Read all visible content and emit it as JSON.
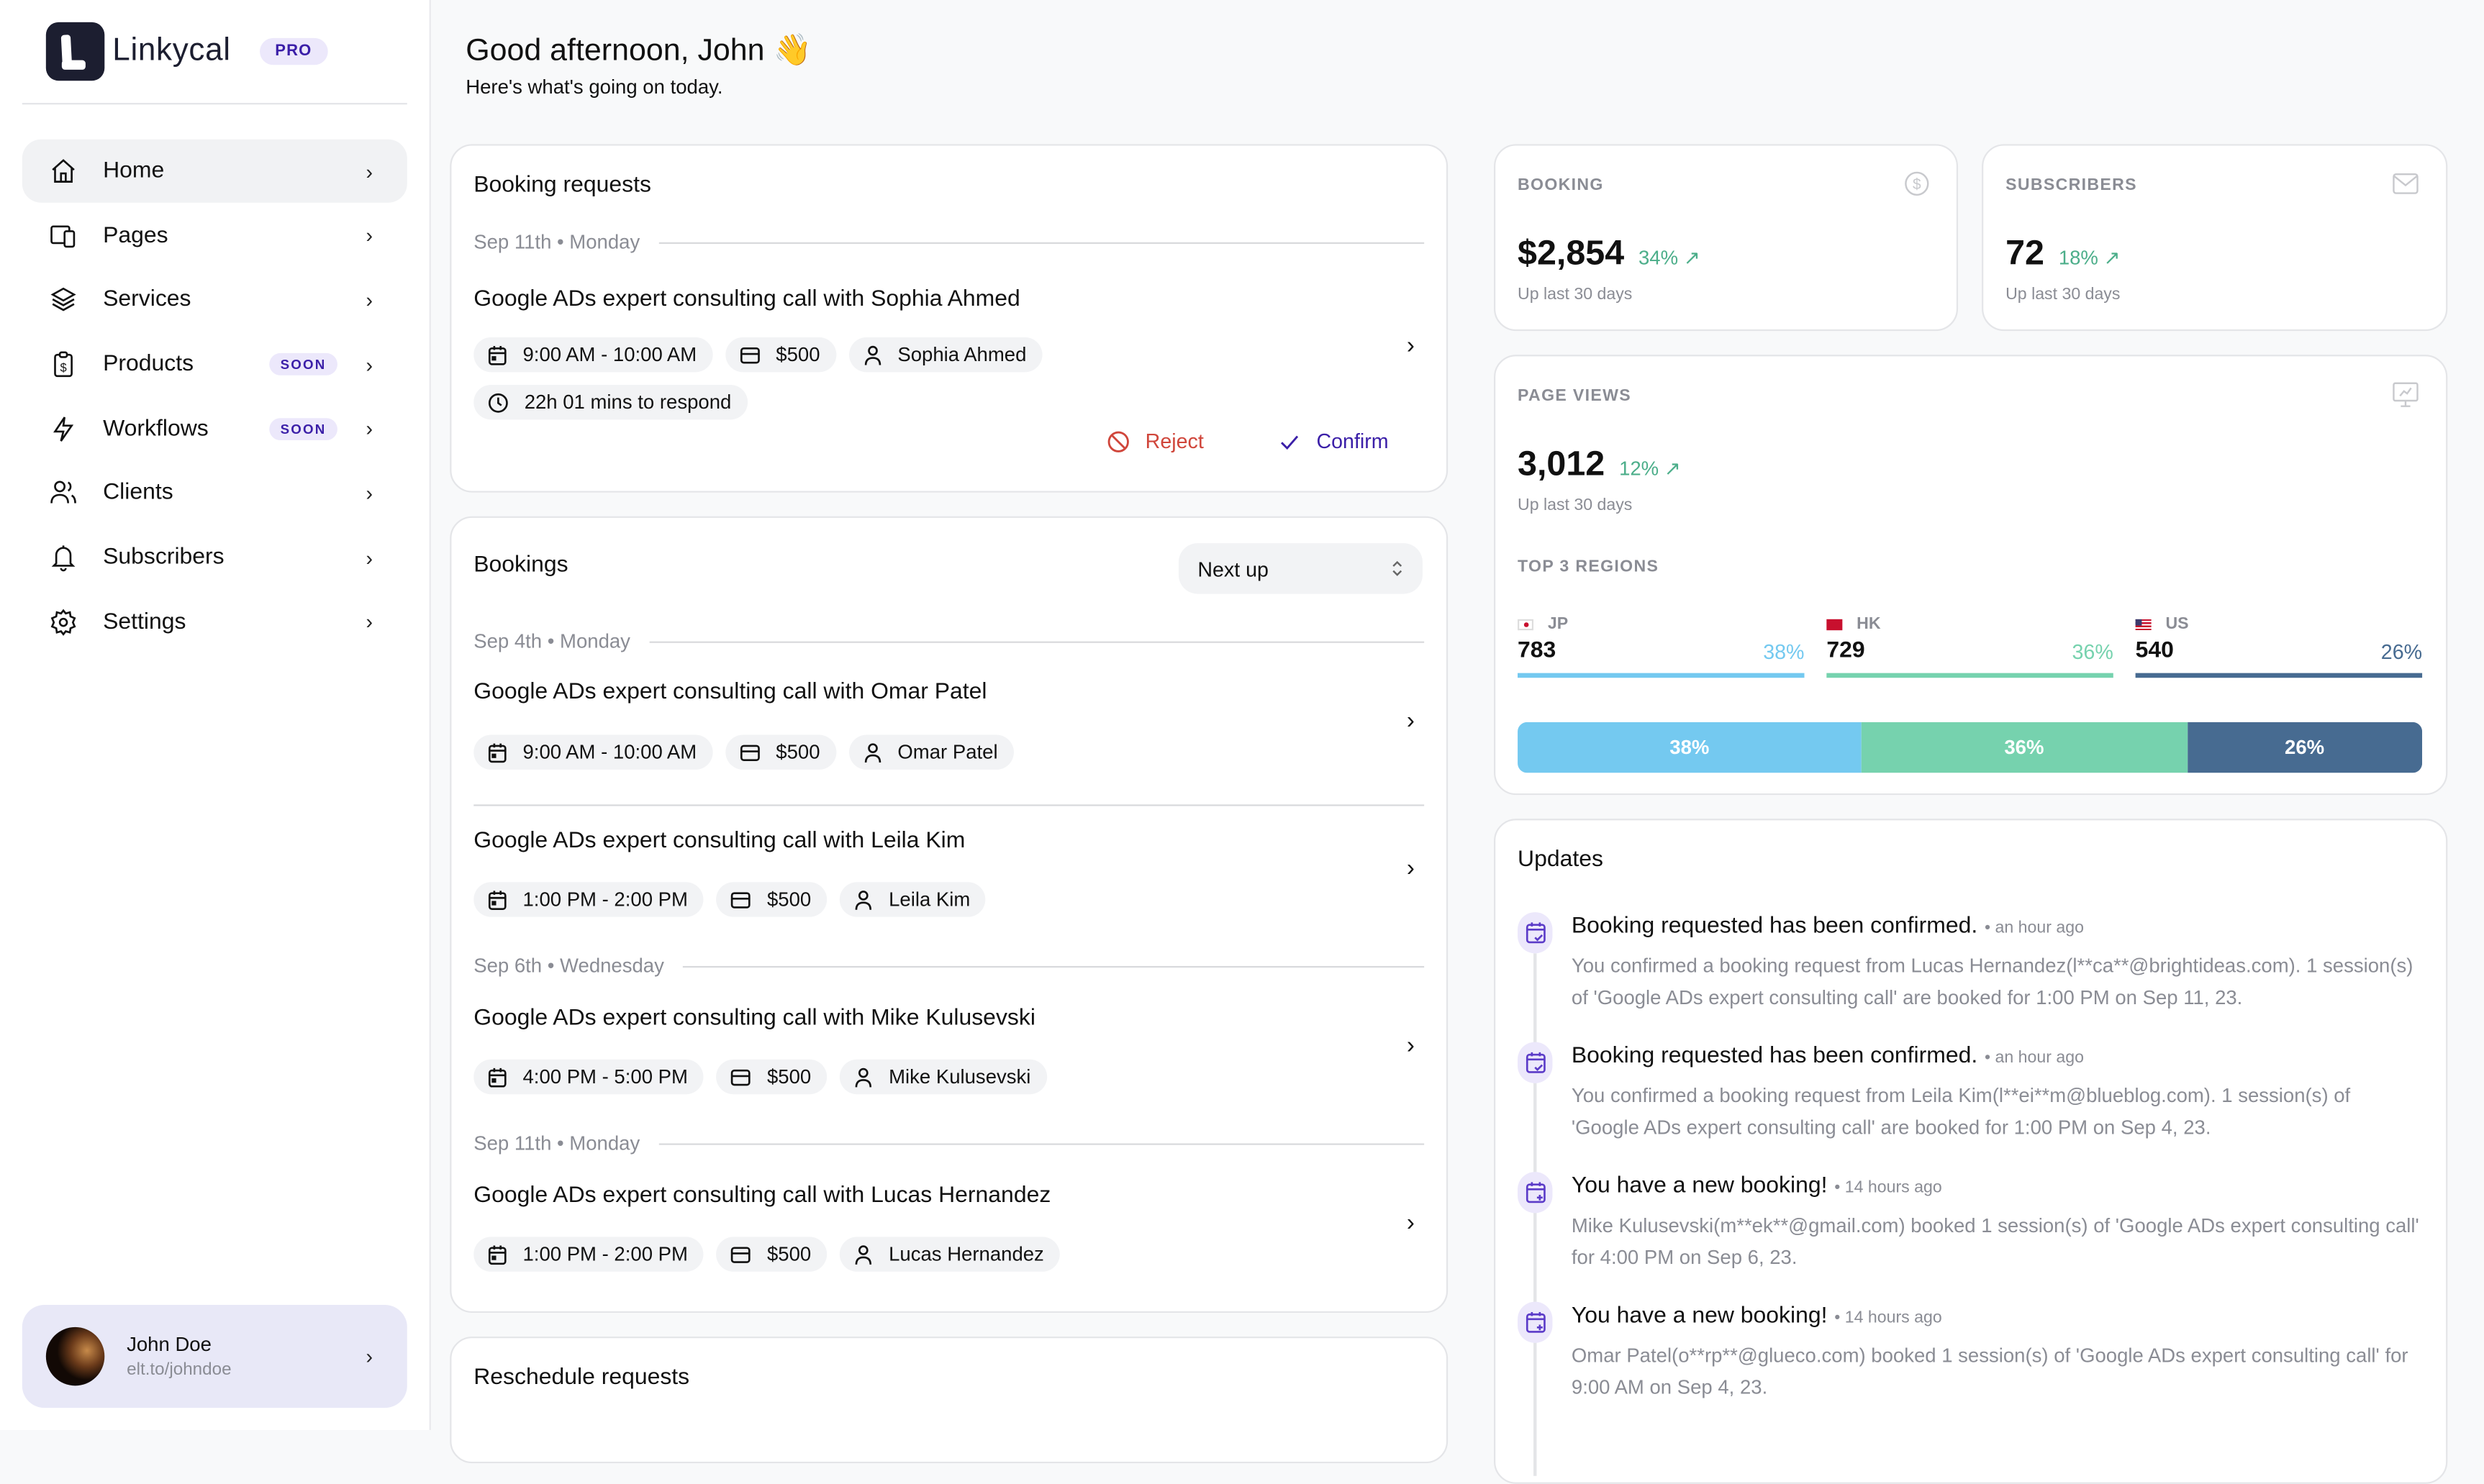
{
  "app": {
    "name": "Linkycal",
    "plan_badge": "PRO"
  },
  "sidebar": {
    "items": [
      {
        "label": "Home",
        "icon": "home-icon",
        "active": true,
        "badge": ""
      },
      {
        "label": "Pages",
        "icon": "pages-icon",
        "active": false,
        "badge": ""
      },
      {
        "label": "Services",
        "icon": "layers-icon",
        "active": false,
        "badge": ""
      },
      {
        "label": "Products",
        "icon": "clipboard-dollar-icon",
        "active": false,
        "badge": "SOON"
      },
      {
        "label": "Workflows",
        "icon": "lightning-icon",
        "active": false,
        "badge": "SOON"
      },
      {
        "label": "Clients",
        "icon": "users-icon",
        "active": false,
        "badge": ""
      },
      {
        "label": "Subscribers",
        "icon": "bell-icon",
        "active": false,
        "badge": ""
      },
      {
        "label": "Settings",
        "icon": "gear-icon",
        "active": false,
        "badge": ""
      }
    ],
    "profile": {
      "name": "John Doe",
      "link": "elt.to/johndoe"
    }
  },
  "header": {
    "greeting": "Good afternoon, John 👋",
    "subtitle": "Here's what's going on today."
  },
  "booking_requests": {
    "title": "Booking requests",
    "date": "Sep 11th • Monday",
    "event_title": "Google ADs expert consulting call with Sophia Ahmed",
    "time": "9:00 AM - 10:00 AM",
    "price": "$500",
    "client": "Sophia Ahmed",
    "respond": "22h 01 mins to respond",
    "reject_label": "Reject",
    "confirm_label": "Confirm"
  },
  "bookings": {
    "title": "Bookings",
    "sort_selected": "Next up",
    "groups": [
      {
        "date": "Sep 4th • Monday",
        "items": [
          {
            "title": "Google ADs expert consulting call with Omar Patel",
            "time": "9:00 AM - 10:00 AM",
            "price": "$500",
            "client": "Omar Patel"
          },
          {
            "title": "Google ADs expert consulting call with Leila Kim",
            "time": "1:00 PM - 2:00 PM",
            "price": "$500",
            "client": "Leila Kim"
          }
        ]
      },
      {
        "date": "Sep 6th • Wednesday",
        "items": [
          {
            "title": "Google ADs expert consulting call with Mike Kulusevski",
            "time": "4:00 PM - 5:00 PM",
            "price": "$500",
            "client": "Mike Kulusevski"
          }
        ]
      },
      {
        "date": "Sep 11th • Monday",
        "items": [
          {
            "title": "Google ADs expert consulting call with Lucas Hernandez",
            "time": "1:00 PM - 2:00 PM",
            "price": "$500",
            "client": "Lucas Hernandez"
          }
        ]
      }
    ]
  },
  "reschedule_requests": {
    "title": "Reschedule requests"
  },
  "stats": {
    "booking": {
      "label": "BOOKING",
      "value": "$2,854",
      "delta": "34% ↗",
      "sub": "Up last 30 days"
    },
    "subscribers": {
      "label": "SUBSCRIBERS",
      "value": "72",
      "delta": "18% ↗",
      "sub": "Up last 30 days"
    },
    "page_views": {
      "label": "PAGE VIEWS",
      "value": "3,012",
      "delta": "12% ↗",
      "sub": "Up last 30 days",
      "regions_title": "TOP 3 REGIONS",
      "regions": [
        {
          "code": "JP",
          "value": "783",
          "pct": "38%",
          "share": 38,
          "color": "#74c9f0"
        },
        {
          "code": "HK",
          "value": "729",
          "pct": "36%",
          "share": 36,
          "color": "#76d2ae"
        },
        {
          "code": "US",
          "value": "540",
          "pct": "26%",
          "share": 26,
          "color": "#476b91"
        }
      ]
    }
  },
  "updates": {
    "title": "Updates",
    "items": [
      {
        "title": "Booking requested has been confirmed.",
        "time": "• an hour ago",
        "icon": "calendar-check-icon",
        "body": "You confirmed a booking request from Lucas Hernandez(l**ca**@brightideas.com). 1 session(s) of 'Google ADs expert consulting call' are booked for 1:00 PM on Sep 11, 23."
      },
      {
        "title": "Booking requested has been confirmed.",
        "time": "• an hour ago",
        "icon": "calendar-check-icon",
        "body": "You confirmed a booking request from Leila Kim(l**ei**m@blueblog.com). 1 session(s) of 'Google ADs expert consulting call' are booked for 1:00 PM on Sep 4, 23."
      },
      {
        "title": "You have a new booking!",
        "time": "• 14 hours ago",
        "icon": "calendar-plus-icon",
        "body": "Mike Kulusevski(m**ek**@gmail.com) booked 1 session(s) of 'Google ADs expert consulting call' for 4:00 PM on Sep 6, 23."
      },
      {
        "title": "You have a new booking!",
        "time": "• 14 hours ago",
        "icon": "calendar-plus-icon",
        "body": "Omar Patel(o**rp**@glueco.com) booked 1 session(s) of 'Google ADs expert consulting call' for 9:00 AM on Sep 4, 23."
      }
    ]
  },
  "colors": {
    "accent": "#3b1fa8",
    "reject": "#d0463b",
    "positive": "#4cae8a"
  }
}
